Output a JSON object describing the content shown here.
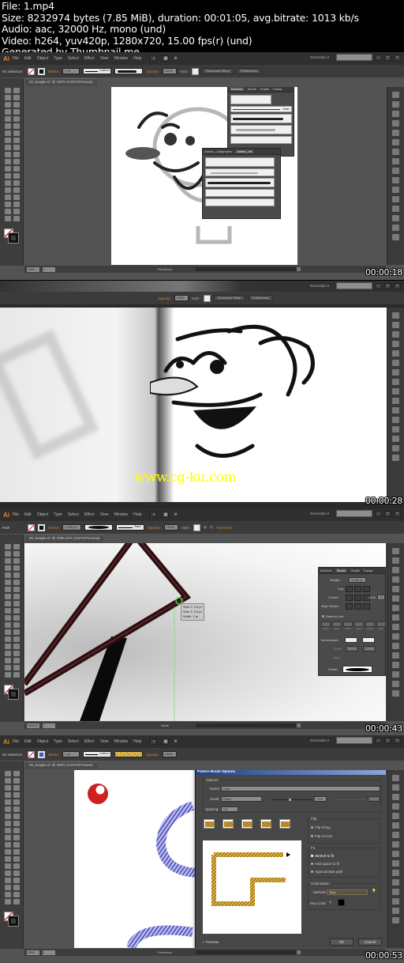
{
  "header": {
    "lines": [
      "File: 1.mp4",
      "Size: 8232974 bytes (7.85 MiB), duration: 00:01:05, avg.bitrate: 1013 kb/s",
      "Audio: aac, 32000 Hz, mono (und)",
      "Video: h264, yuv420p, 1280x720, 15.00 fps(r) (und)",
      "Generated by Thumbnail me"
    ]
  },
  "app": {
    "logo": "Ai",
    "menu": [
      "File",
      "Edit",
      "Object",
      "Type",
      "Select",
      "Effect",
      "View",
      "Window",
      "Help"
    ],
    "workspace": "Essentials ▾",
    "window_buttons": [
      "–",
      "□",
      "×"
    ],
    "accent": "#d9822b"
  },
  "frames": [
    {
      "timestamp": "00:00:18",
      "control": {
        "selection": "No Selection",
        "stroke_label": "Stroke:",
        "stroke_value": "1 pt",
        "uniform": "Uniform",
        "opacity_label": "Opacity:",
        "opacity_value": "100%",
        "style_label": "Style:",
        "doc_setup": "Document Setup",
        "preferences": "Preferences"
      },
      "doc_tab": "02_beagle.ai* @ 150% (CMYK/Preview)",
      "status": {
        "zoom": "150%",
        "page": "1",
        "tool": "Paintbrush"
      },
      "panels": [
        {
          "tabs": [
            "Brushes",
            "Stroke",
            "Gradie",
            "Transp"
          ],
          "active": 0,
          "basic_label": "Basic"
        },
        {
          "tabs": [
            "Artistic_Calligraphic",
            "Artistic_Ink"
          ],
          "active": 1
        }
      ]
    },
    {
      "timestamp": "00:00:28",
      "control": {
        "opacity_label": "Opacity:",
        "opacity_value": "100%",
        "style_label": "Style:",
        "doc_setup": "Document Setup",
        "preferences": "Preferences"
      },
      "workspace": "Essentials ▾",
      "watermark": "www.cg-ku.com"
    },
    {
      "timestamp": "00:00:43",
      "control": {
        "selection": "Path",
        "stroke_label": "Stroke:",
        "stroke_value": "3.045 pt",
        "basic": "Basic",
        "opacity_label": "Opacity:",
        "opacity_value": "100%",
        "style_label": "Style:",
        "transform": "Transform"
      },
      "doc_tab": "05_beagle.ai* @ 2956.22% (CMYK/Preview)",
      "status": {
        "zoom": "2956.22",
        "page": "1",
        "tool": "Width"
      },
      "width_tooltip": [
        "Side 1: 0.5 pt",
        "Side 2: 0.5 pt",
        "Width: 1 pt"
      ],
      "stroke_panel": {
        "tabs": [
          "Brushes",
          "Stroke",
          "Gradie",
          "Transp"
        ],
        "active": 1,
        "weight_label": "Weight:",
        "weight_value": "3.045 pt",
        "cap_label": "Cap:",
        "corner_label": "Corner:",
        "limit_label": "Limit:",
        "limit_value": "10",
        "align_label": "Align Stroke:",
        "dashed_label": "Dashed Line",
        "dash_fields": [
          "dash",
          "gap",
          "dash",
          "gap",
          "dash",
          "gap"
        ],
        "arrowheads_label": "Arrowheads:",
        "scale_label": "Scale:",
        "scale_values": [
          "100%",
          "100%"
        ],
        "align_label2": "Align:",
        "profile_label": "Profile:"
      }
    },
    {
      "timestamp": "00:00:53",
      "control": {
        "selection": "No Selection",
        "stroke_label": "Stroke:",
        "stroke_value": "1 pt",
        "uniform": "Uniform",
        "opacity_label": "Opacity:",
        "opacity_value": "100%"
      },
      "doc_tab": "06_beagle.ai* @ 200% (CMYK/Preview)",
      "status": {
        "zoom": "200%",
        "page": "1",
        "tool": "Paintbrush"
      },
      "dialog": {
        "title": "Pattern Brush Options",
        "options_label": "Options",
        "name_label": "Name:",
        "name_value": "rope",
        "scale_label": "Scale:",
        "scale_mode": "Fixed",
        "scale_value": "71%",
        "scale_max": "100%",
        "spacing_label": "Spacing:",
        "spacing_value": "0%",
        "flip_label": "Flip",
        "flip_along": "Flip Along",
        "flip_across": "Flip Across",
        "fit_label": "Fit",
        "fit_options": [
          "Stretch to fit",
          "Add space to fit",
          "Approximate path"
        ],
        "fit_selected": 0,
        "colorization_label": "Colorization",
        "method_label": "Method:",
        "method_value": "Tints",
        "key_color_label": "Key Color:",
        "preview_label": "Preview",
        "preview_checked": true,
        "ok": "OK",
        "cancel": "Cancel"
      }
    }
  ]
}
